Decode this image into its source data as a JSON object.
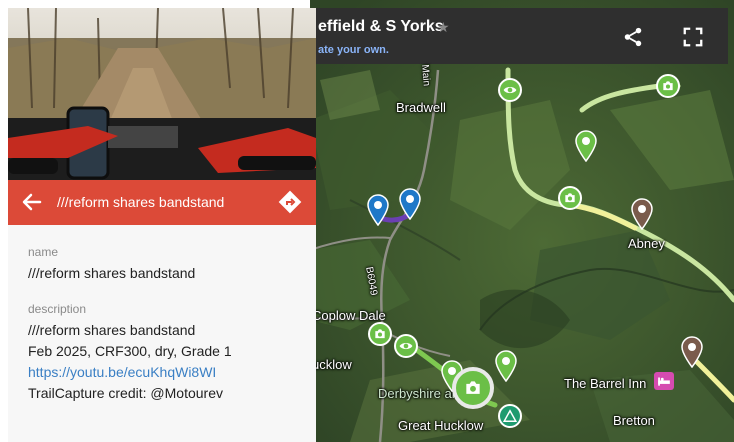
{
  "map": {
    "title": "effield & S Yorks",
    "subtitle": "ate your own.",
    "icons": {
      "star": "star-icon",
      "share": "share-icon",
      "fullscreen": "fullscreen-icon",
      "camera": "camera-icon",
      "eye": "viewpoint-icon",
      "campsite": "campsite-icon",
      "bed": "bed-icon"
    },
    "labels": {
      "bradwell": "Bradwell",
      "abney": "Abney",
      "coplow_dale": "Coplow Dale",
      "hucklow": "ucklow",
      "barrel_inn": "The Barrel Inn",
      "campsite": "Derbyshire ampsite",
      "bretton": "Bretton",
      "great_hucklow": "Great Hucklow",
      "road_b6049": "B6049",
      "road_main": "Main"
    },
    "colors": {
      "trail": "#c9e6a0",
      "trail_highlight": "#f1f19a",
      "selected_segment": "#6b3fb2",
      "pin_blue": "#1f78c8",
      "pin_green": "#6bbf47",
      "pin_brown": "#7a5b4c",
      "campsite": "#1e9b6f",
      "bed": "#d64bb0"
    }
  },
  "photo": {
    "description_icon": "trail-photo"
  },
  "header": {
    "title": "///reform shares bandstand",
    "back_icon": "back-arrow-icon",
    "directions_icon": "directions-icon",
    "color": "#dc4a38"
  },
  "details": {
    "name_label": "name",
    "name_value": "///reform shares bandstand",
    "description_label": "description",
    "description_line1": "///reform shares bandstand",
    "description_line2": "Feb 2025, CRF300, dry, Grade 1",
    "description_link": "https://youtu.be/ecuKhqWi8WI",
    "description_line4": "TrailCapture credit: @Motourev"
  }
}
